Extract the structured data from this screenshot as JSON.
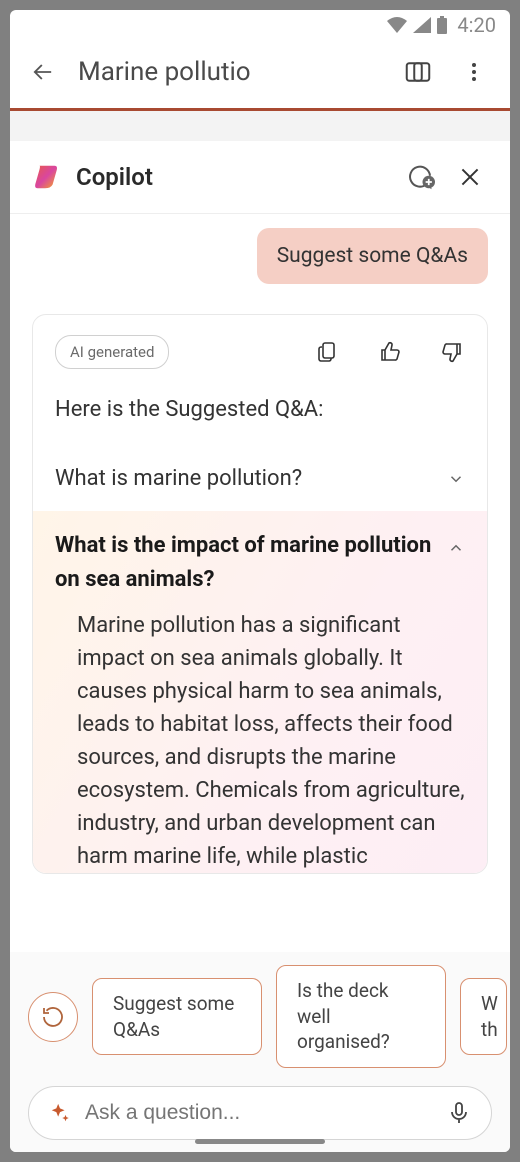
{
  "status": {
    "time": "4:20"
  },
  "header": {
    "title": "Marine pollutio"
  },
  "copilot": {
    "title": "Copilot"
  },
  "userMessage": "Suggest some Q&As",
  "card": {
    "aiBadge": "AI generated",
    "intro": "Here is the Suggested Q&A:",
    "qa1": {
      "question": "What is marine pollution?"
    },
    "qa2": {
      "question": "What is the impact of marine pollution on sea animals?",
      "answer": "Marine pollution has a significant impact on sea animals globally. It causes physical harm to sea animals, leads to habitat loss, affects their food sources, and disrupts the marine ecosystem. Chemicals from agriculture, industry, and urban development can harm marine life, while plastic"
    }
  },
  "suggestions": {
    "s1": "Suggest some Q&As",
    "s2": "Is the deck well organised?",
    "s3": "W\nth"
  },
  "input": {
    "placeholder": "Ask a question..."
  }
}
